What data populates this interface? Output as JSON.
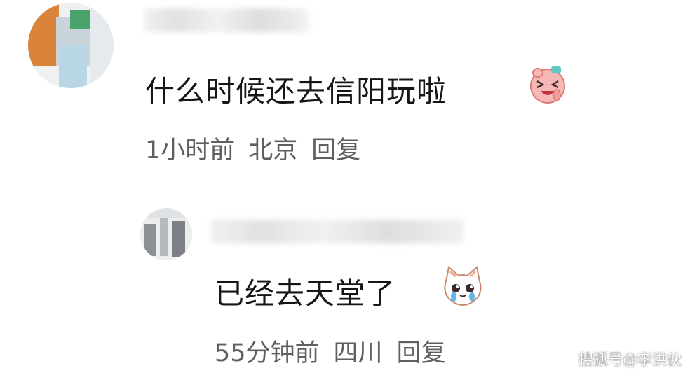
{
  "comments": [
    {
      "text": "什么时候还去信阳玩啦",
      "time": "1小时前",
      "location": "北京",
      "reply_label": "回复",
      "emoji_icon": "laughing-pink-face-icon"
    },
    {
      "text": "已经去天堂了",
      "time": "55分钟前",
      "location": "四川",
      "reply_label": "回复",
      "emoji_icon": "crying-cat-face-icon"
    }
  ],
  "watermark": "搜狐号@李洪伙",
  "colors": {
    "text": "#161616",
    "meta": "#5f5f5f",
    "background": "#ffffff"
  }
}
